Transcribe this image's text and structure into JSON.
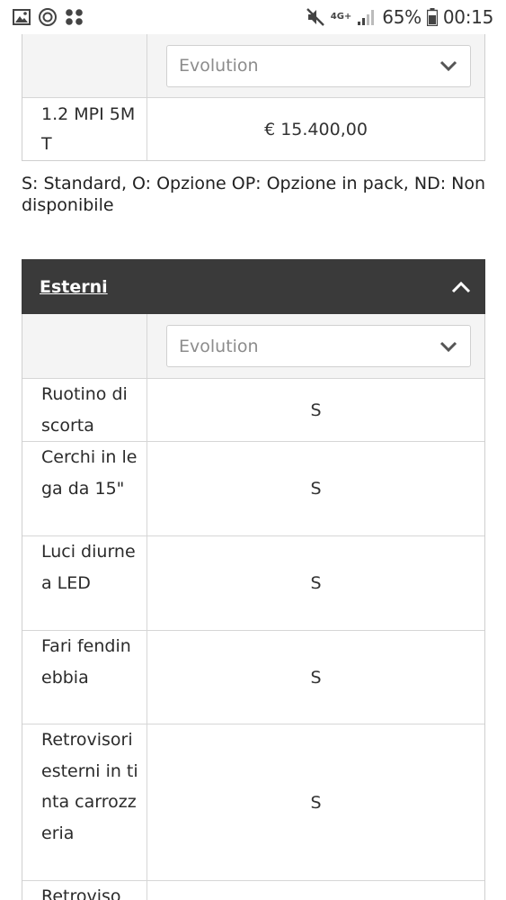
{
  "status_bar": {
    "network": "4G+",
    "battery": "65%",
    "time": "00:15"
  },
  "price_table": {
    "select_value": "Evolution",
    "rows": [
      {
        "label": "1.2 MPI 5MT",
        "value": "€ 15.400,00"
      }
    ]
  },
  "legend": "S: Standard, O: Opzione OP: Opzione in pack, ND: Non disponibile",
  "section": {
    "title": "Esterni",
    "select_value": "Evolution",
    "rows": [
      {
        "label": "Ruotino di scorta",
        "value": "S"
      },
      {
        "label": "Cerchi in lega da 15\"",
        "value": "S"
      },
      {
        "label": "Luci diurne a LED",
        "value": "S"
      },
      {
        "label": "Fari fendinebbia",
        "value": "S"
      },
      {
        "label": "Retrovisori esterni in tinta carrozzeria",
        "value": "S"
      },
      {
        "label": "Retroviso",
        "value": ""
      }
    ]
  }
}
